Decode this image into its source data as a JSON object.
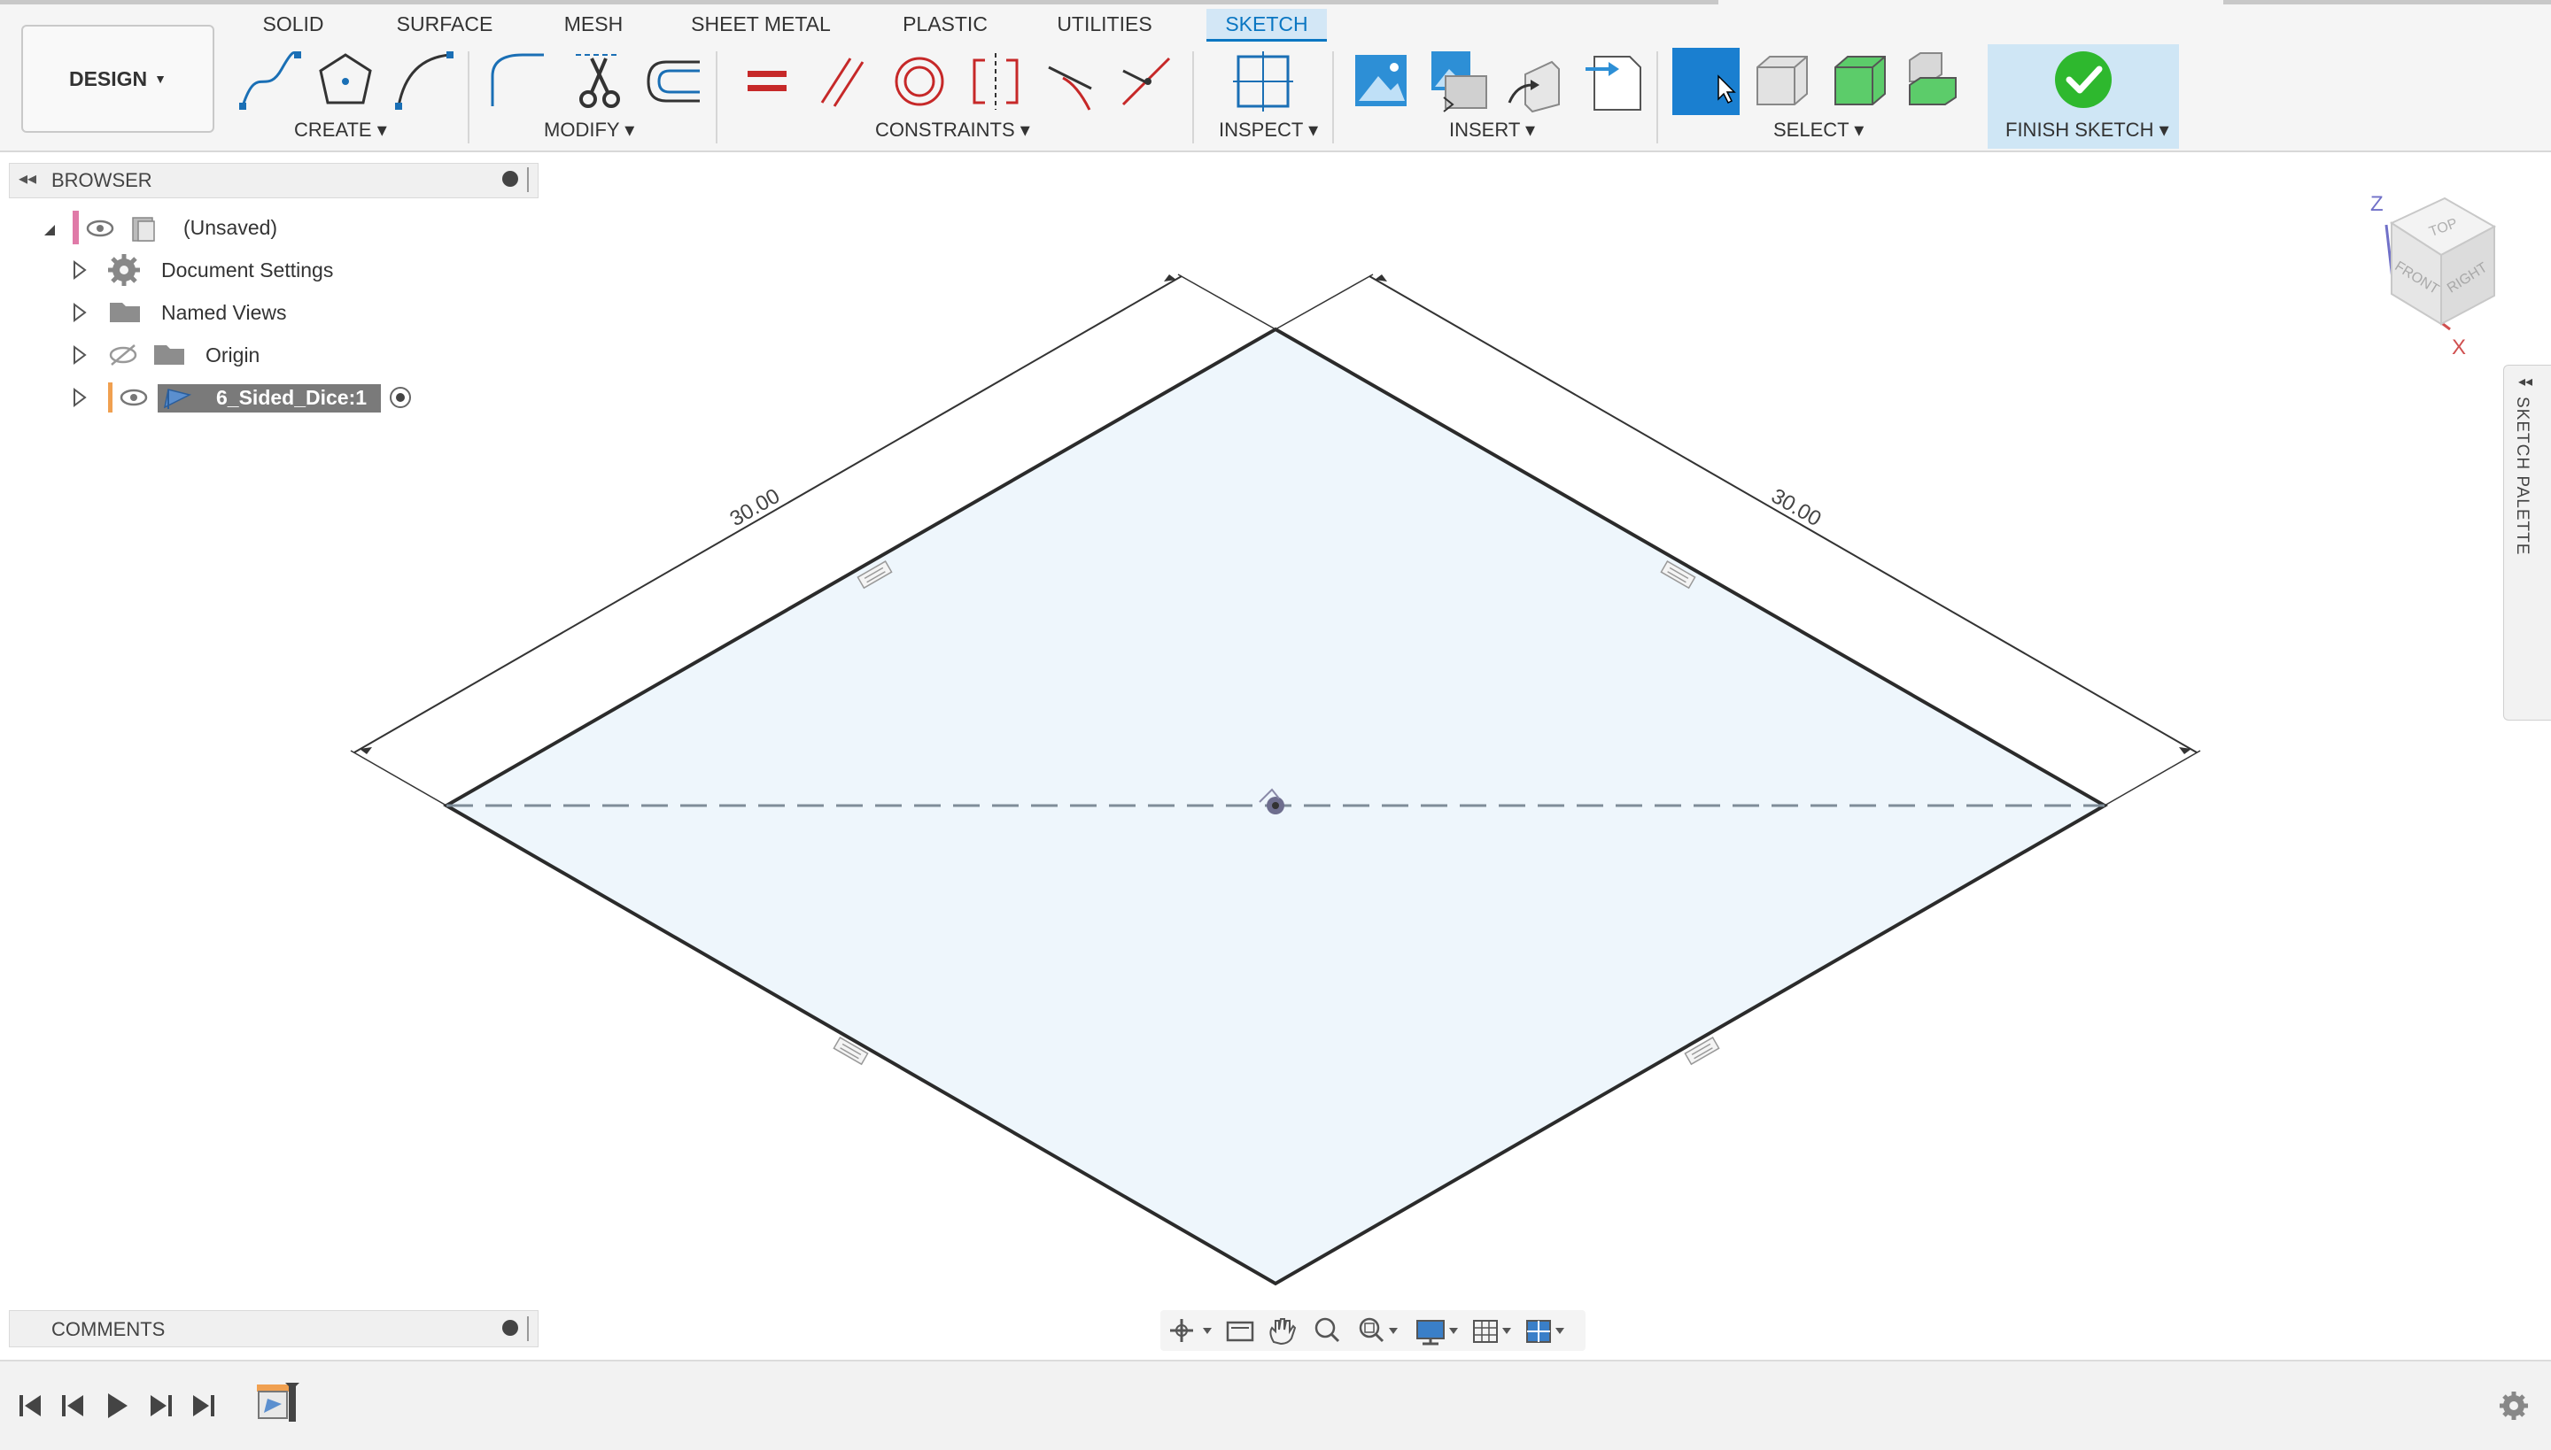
{
  "toolbar": {
    "tabs": [
      "SOLID",
      "SURFACE",
      "MESH",
      "SHEET METAL",
      "PLASTIC",
      "UTILITIES",
      "SKETCH"
    ],
    "active_tab": "SKETCH",
    "design_label": "DESIGN",
    "groups": {
      "create": "CREATE",
      "modify": "MODIFY",
      "constraints": "CONSTRAINTS",
      "inspect": "INSPECT",
      "insert": "INSERT",
      "select": "SELECT",
      "finish": "FINISH SKETCH"
    }
  },
  "browser": {
    "title": "BROWSER",
    "items": [
      {
        "label": "(Unsaved)"
      },
      {
        "label": "Document Settings"
      },
      {
        "label": "Named Views"
      },
      {
        "label": "Origin"
      },
      {
        "label": "6_Sided_Dice:1"
      }
    ]
  },
  "comments": {
    "title": "COMMENTS"
  },
  "canvas": {
    "dim_left": "30.00",
    "dim_right": "30.00"
  },
  "viewcube": {
    "top": "TOP",
    "front": "FRONT",
    "right": "RIGHT",
    "axis_z": "Z",
    "axis_x": "X"
  },
  "sketch_palette": {
    "label": "SKETCH PALETTE"
  },
  "colors": {
    "accent": "#0a76c2",
    "sketch_fill": "#eef6fc",
    "finish_check": "#2eb82e",
    "select_active": "#1a7fd0"
  }
}
